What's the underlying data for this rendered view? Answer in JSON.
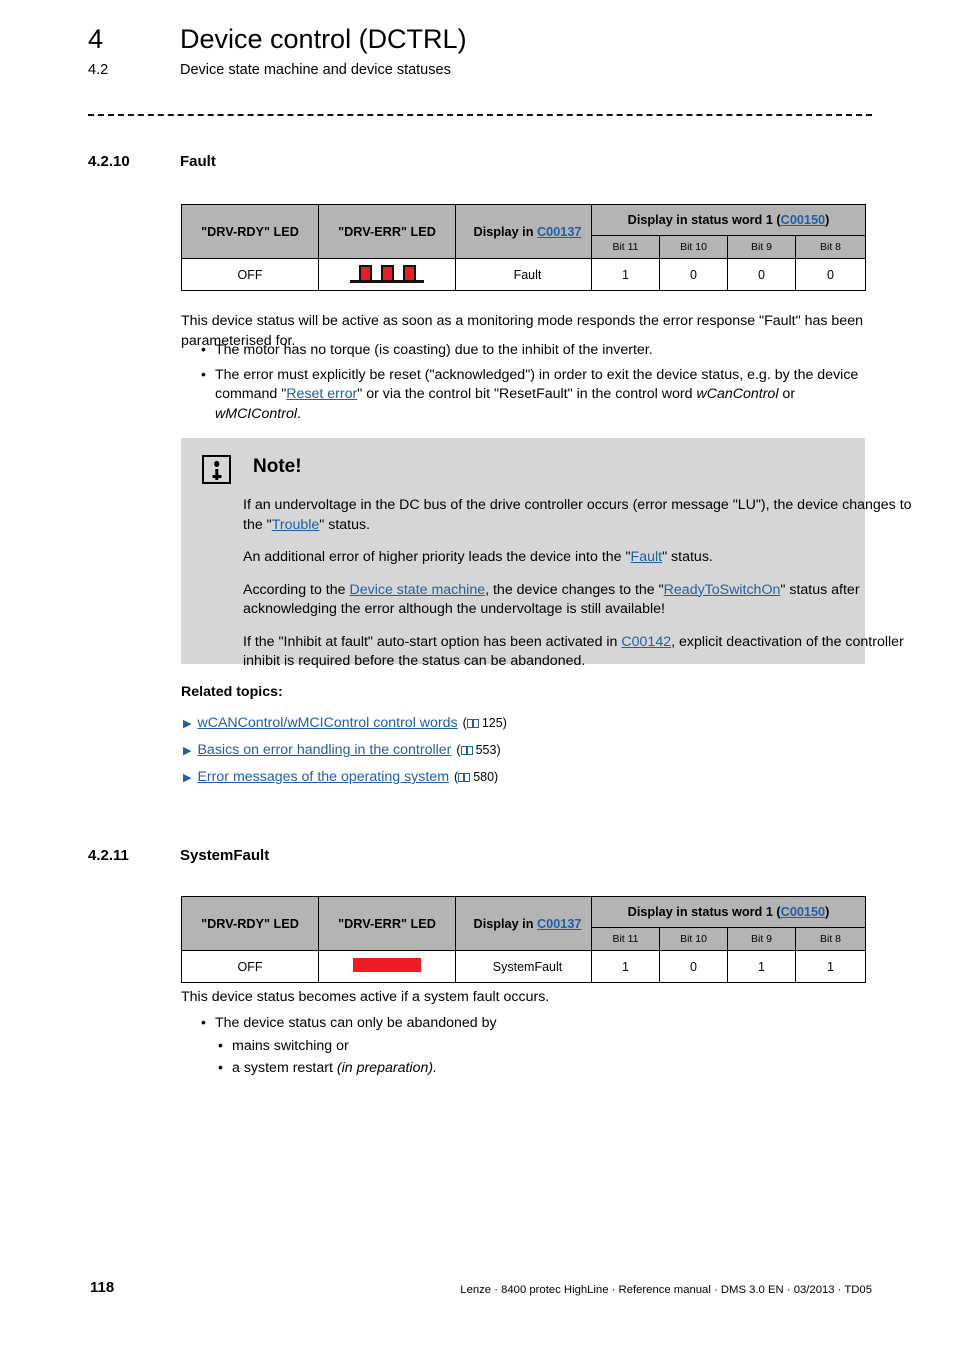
{
  "header": {
    "chapter_number": "4",
    "chapter_title": "Device control (DCTRL)",
    "section_number": "4.2",
    "section_title": "Device state machine and device statuses"
  },
  "sections": [
    {
      "number": "4.2.10",
      "title": "Fault",
      "table": {
        "headers": {
          "drv_rdy": "\"DRV-RDY\" LED",
          "drv_err": "\"DRV-ERR\" LED",
          "display_in": "Display in ",
          "display_in_code": "C00137",
          "status_word_pre": "Display in status word 1 (",
          "status_word_code": "C00150",
          "status_word_post": ")",
          "bits": [
            "Bit 11",
            "Bit 10",
            "Bit 9",
            "Bit 8"
          ]
        },
        "row": {
          "drv_rdy": "OFF",
          "drv_err_icon": "led-blink-3-pulse-red",
          "display": "Fault",
          "bits": [
            "1",
            "0",
            "0",
            "0"
          ]
        }
      },
      "intro": "This device status will be active as soon as a monitoring mode responds the error response \"Fault\" has been parameterised for.",
      "bullets": [
        {
          "parts": [
            {
              "t": "The motor has no torque (is coasting) due to the inhibit of the inverter.",
              "k": "plain"
            }
          ]
        },
        {
          "parts": [
            {
              "t": "The error must explicitly be reset (\"acknowledged\") in order to exit the device status, e.g. by the device command \"",
              "k": "plain"
            },
            {
              "t": "Reset error",
              "k": "link"
            },
            {
              "t": "\" or via the control bit \"ResetFault\" in the control word ",
              "k": "plain"
            },
            {
              "t": "wCanControl",
              "k": "italic"
            },
            {
              "t": " or ",
              "k": "plain"
            },
            {
              "t": "wMCIControl",
              "k": "italic"
            },
            {
              "t": ".",
              "k": "plain"
            }
          ]
        }
      ]
    },
    {
      "number": "4.2.11",
      "title": "SystemFault",
      "table": {
        "row": {
          "drv_rdy": "OFF",
          "drv_err_icon": "led-solid-red",
          "display": "SystemFault",
          "bits": [
            "1",
            "0",
            "1",
            "1"
          ]
        }
      },
      "intro": "This device status becomes active if a system fault occurs.",
      "bullet": "The device status can only be abandoned by",
      "subbullets": [
        {
          "parts": [
            {
              "t": "mains switching or",
              "k": "plain"
            }
          ]
        },
        {
          "parts": [
            {
              "t": "a system restart ",
              "k": "plain"
            },
            {
              "t": "(in preparation).",
              "k": "italic"
            }
          ]
        }
      ]
    }
  ],
  "note": {
    "icon": "info-icon",
    "title": "Note!",
    "paragraphs": [
      [
        {
          "t": "If an undervoltage in the DC bus of the drive controller occurs (error message \"LU\"), the device changes to the \"",
          "k": "plain"
        },
        {
          "t": "Trouble",
          "k": "link"
        },
        {
          "t": "\" status.",
          "k": "plain"
        }
      ],
      [
        {
          "t": "An additional error of higher priority leads the device into the \"",
          "k": "plain"
        },
        {
          "t": "Fault",
          "k": "link"
        },
        {
          "t": "\" status.",
          "k": "plain"
        }
      ],
      [
        {
          "t": "According to the ",
          "k": "plain"
        },
        {
          "t": "Device state machine",
          "k": "link"
        },
        {
          "t": ", the device changes to the \"",
          "k": "plain"
        },
        {
          "t": "ReadyToSwitchOn",
          "k": "link"
        },
        {
          "t": "\" status after acknowledging the error although the undervoltage is still available!",
          "k": "plain"
        }
      ],
      [
        {
          "t": "If the \"Inhibit at fault\" auto-start option has been activated in ",
          "k": "plain"
        },
        {
          "t": "C00142",
          "k": "link"
        },
        {
          "t": ",  explicit deactivation of the controller inhibit is required before the status can be abandoned.",
          "k": "plain"
        }
      ]
    ]
  },
  "related_topics": {
    "title": "Related topics:",
    "items": [
      {
        "label": "wCANControl/wMCIControl control words",
        "page": "125"
      },
      {
        "label": "Basics on error handling in the controller",
        "page": "553"
      },
      {
        "label": "Error messages of the operating system",
        "page": "580"
      }
    ]
  },
  "footer": {
    "page_number": "118",
    "text": "Lenze · 8400 protec HighLine · Reference manual · DMS 3.0 EN · 03/2013 · TD05"
  },
  "colors": {
    "table_header_gray": "#b4b4b4",
    "note_bg_gray": "#d6d6d6",
    "link_blue": "#1f5fa9",
    "led_red": "#ed1c24"
  }
}
